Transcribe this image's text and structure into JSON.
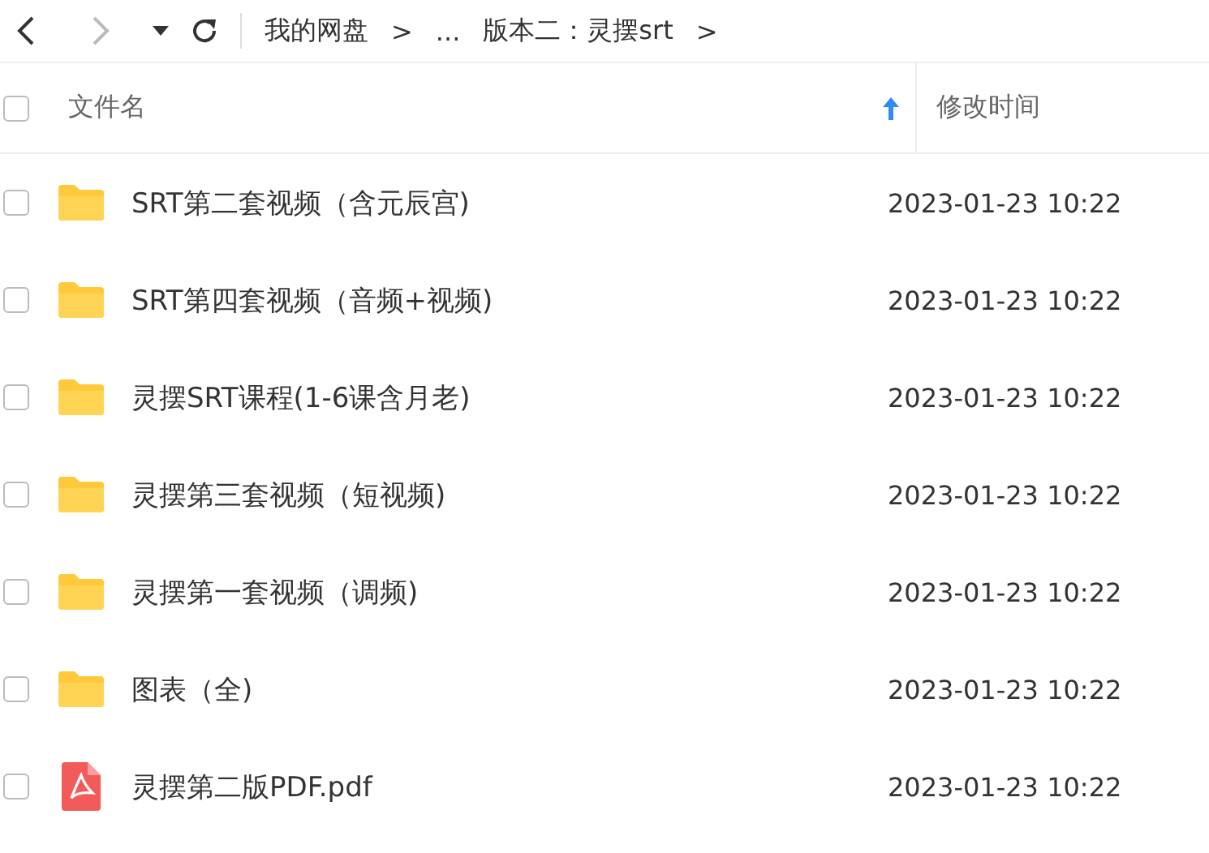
{
  "nav": {
    "back_disabled": false,
    "forward_disabled": true
  },
  "breadcrumb": [
    {
      "label": "我的网盘"
    },
    {
      "label": ">"
    },
    {
      "label": "..."
    },
    {
      "label": "版本二：灵摆srt"
    },
    {
      "label": ">"
    }
  ],
  "header": {
    "checked": false,
    "columns": [
      {
        "label": "文件名",
        "sorted": true
      },
      {
        "label": "修改时间",
        "sorted": false
      }
    ]
  },
  "rows": [
    {
      "kind": "folder",
      "name": "SRT第二套视频（含元辰宫)",
      "modified": "2023-01-23 10:22",
      "checked": false
    },
    {
      "kind": "folder",
      "name": "SRT第四套视频（音频+视频)",
      "modified": "2023-01-23 10:22",
      "checked": false
    },
    {
      "kind": "folder",
      "name": "灵摆SRT课程(1-6课含月老)",
      "modified": "2023-01-23 10:22",
      "checked": false
    },
    {
      "kind": "folder",
      "name": "灵摆第三套视频（短视频)",
      "modified": "2023-01-23 10:22",
      "checked": false
    },
    {
      "kind": "folder",
      "name": "灵摆第一套视频（调频)",
      "modified": "2023-01-23 10:22",
      "checked": false
    },
    {
      "kind": "folder",
      "name": "图表（全)",
      "modified": "2023-01-23 10:22",
      "checked": false
    },
    {
      "kind": "pdf",
      "name": "灵摆第二版PDF.pdf",
      "modified": "2023-01-23 10:22",
      "checked": false
    }
  ]
}
